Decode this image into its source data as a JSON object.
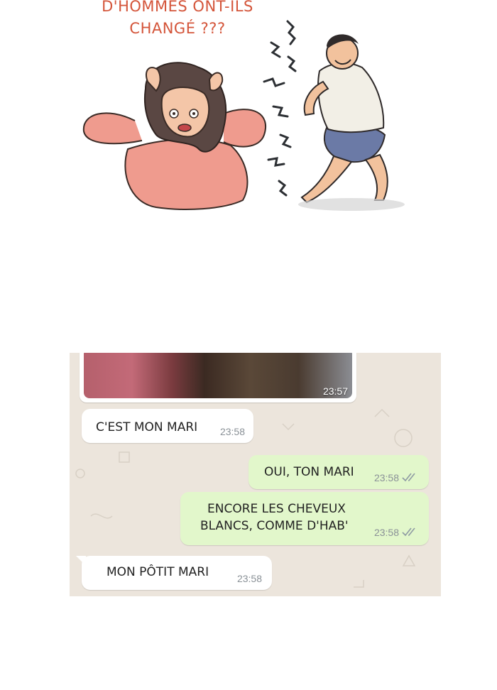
{
  "comic": {
    "caption_line1": "D'HOMMES ONT-ILS",
    "caption_line2": "CHANGÉ ???"
  },
  "chat": {
    "media": {
      "time": "23:57"
    },
    "messages": [
      {
        "direction": "incoming",
        "text": "C'EST MON MARI",
        "time": "23:58",
        "ticks": ""
      },
      {
        "direction": "outgoing",
        "text": "OUI, TON MARI",
        "time": "23:58",
        "ticks": "read"
      },
      {
        "direction": "outgoing",
        "text_line1": "ENCORE LES CHEVEUX",
        "text_line2": "BLANCS, COMME D'HAB'",
        "time": "23:58",
        "ticks": "read"
      },
      {
        "direction": "incoming",
        "text": "MON PÔTIT MARI",
        "time": "23:58",
        "ticks": ""
      }
    ]
  },
  "colors": {
    "caption": "#d4553a",
    "chat_background": "#ece5dc",
    "incoming_bubble": "#ffffff",
    "outgoing_bubble": "#e2f7cb",
    "timestamp": "#8a9197",
    "read_ticks": "#8e9aa3"
  }
}
